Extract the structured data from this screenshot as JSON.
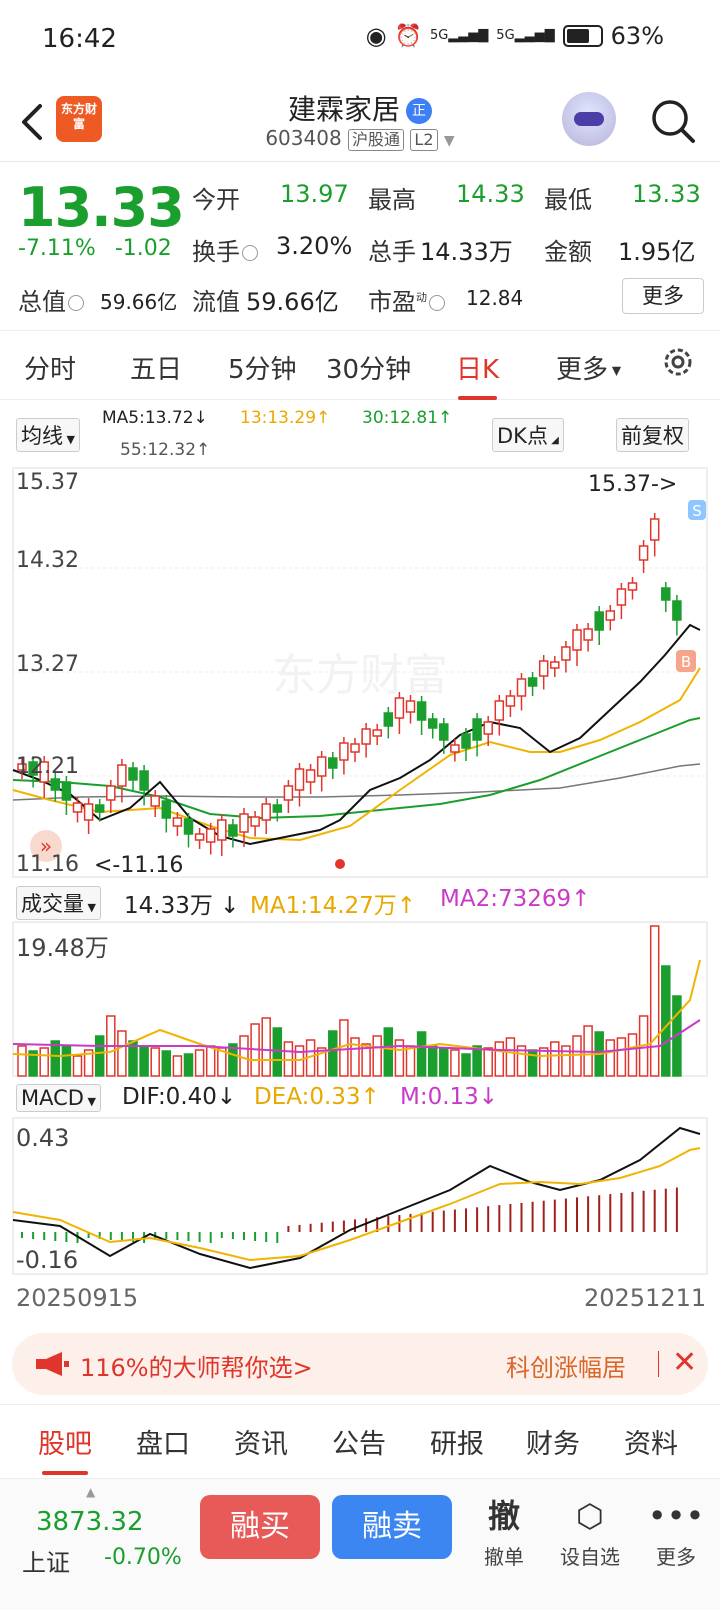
{
  "status": {
    "time": "16:42",
    "signal1": "5G",
    "signal2": "5G",
    "battery": "63%"
  },
  "header": {
    "logo_text": "东方财富",
    "stock_name": "建霖家居",
    "name_badge": "正",
    "code": "603408",
    "tag1": "沪股通",
    "tag2": "L2"
  },
  "quote": {
    "price": "13.33",
    "pct": "-7.11%",
    "change": "-1.02",
    "open_label": "今开",
    "open": "13.97",
    "high_label": "最高",
    "high": "14.33",
    "low_label": "最低",
    "low": "13.33",
    "turnover_label": "换手",
    "turnover": "3.20%",
    "volume_label": "总手",
    "volume": "14.33万",
    "amount_label": "金额",
    "amount": "1.95亿",
    "mktcap_label": "总值",
    "mktcap": "59.66亿",
    "float_label": "流值",
    "float_cap": "59.66亿",
    "pe_label": "市盈",
    "pe_sup": "动",
    "pe": "12.84",
    "more": "更多"
  },
  "tabs": [
    "分时",
    "五日",
    "5分钟",
    "30分钟",
    "日K",
    "更多"
  ],
  "active_tab": "日K",
  "ma_bar": {
    "selector": "均线",
    "ma5": "MA5:13.72↓",
    "ma13": "13:13.29↑",
    "ma30": "30:12.81↑",
    "ma55": "55:12.32↑",
    "dk": "DK点",
    "adjust": "前复权",
    "colors": {
      "ma5": "#222222",
      "ma13": "#e8a800",
      "ma30": "#1a9e2e",
      "ma55": "#555555"
    }
  },
  "kline": {
    "y_labels": [
      "15.37",
      "14.32",
      "13.27",
      "12.21",
      "11.16"
    ],
    "max_annotation": "15.37->",
    "min_annotation": "<-11.16",
    "watermark": "东方财富",
    "marker_s": "S",
    "marker_b": "B"
  },
  "volume": {
    "selector": "成交量",
    "value": "14.33万",
    "value_arrow": "↓",
    "ma1": "MA1:14.27万↑",
    "ma2": "MA2:73269↑",
    "y_max": "19.48万"
  },
  "macd": {
    "selector": "MACD",
    "dif": "DIF:0.40↓",
    "dea": "DEA:0.33↑",
    "m": "M:0.13↓",
    "y_top": "0.43",
    "y_bottom": "-0.16",
    "date_start": "20250915",
    "date_end": "20251211"
  },
  "banner": {
    "text1": "116%的大师帮你选>",
    "text2": "科创涨幅居"
  },
  "bottom_tabs": [
    "股吧",
    "盘口",
    "资讯",
    "公告",
    "研报",
    "财务",
    "资料"
  ],
  "active_bottom_tab": "股吧",
  "footer": {
    "index_value": "3873.32",
    "index_name": "上证",
    "index_change": "-0.70%",
    "buy": "融买",
    "sell": "融卖",
    "cancel_glyph": "撤",
    "cancel": "撤单",
    "watch": "设自选",
    "more": "更多"
  }
}
